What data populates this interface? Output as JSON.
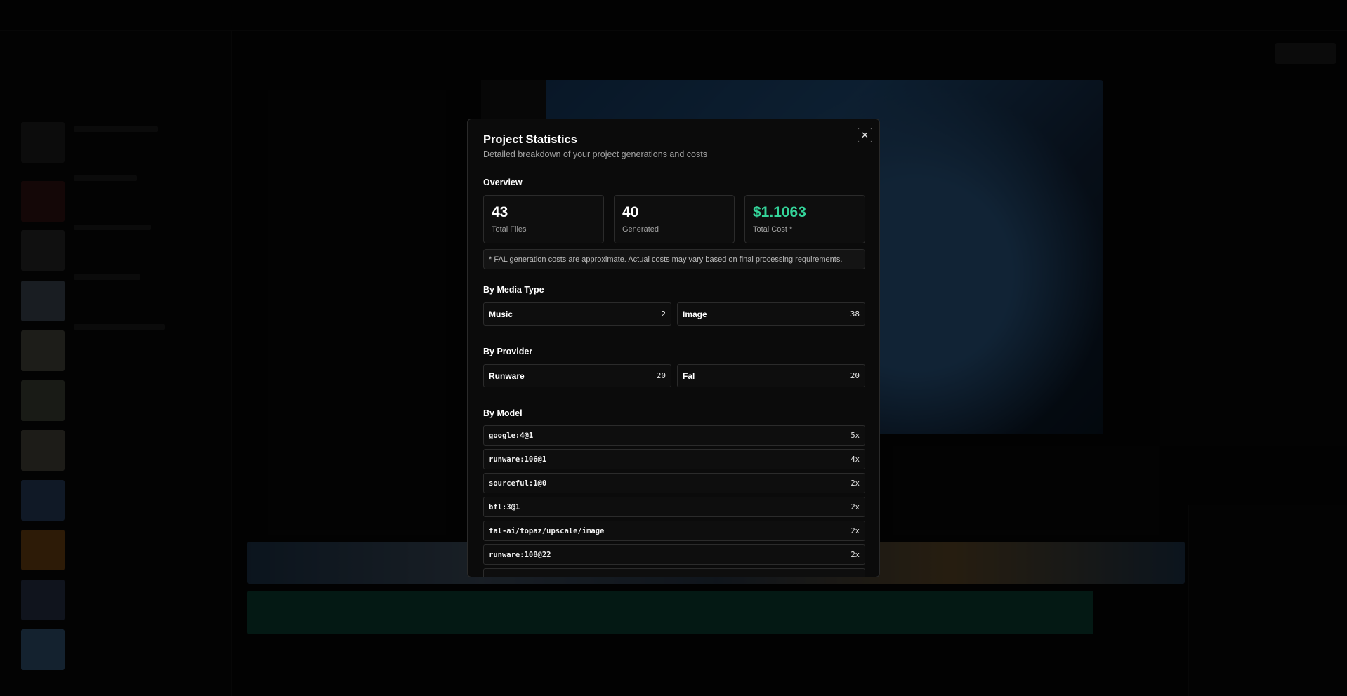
{
  "modal": {
    "title": "Project Statistics",
    "subtitle": "Detailed breakdown of your project generations and costs",
    "close_icon": "close-icon",
    "overview": {
      "heading": "Overview",
      "cards": [
        {
          "value": "43",
          "label": "Total Files"
        },
        {
          "value": "40",
          "label": "Generated"
        },
        {
          "value": "$1.1063",
          "label": "Total Cost *"
        }
      ],
      "note": "* FAL generation costs are approximate. Actual costs may vary based on final processing requirements."
    },
    "media_type": {
      "heading": "By Media Type",
      "items": [
        {
          "name": "Music",
          "count": "2"
        },
        {
          "name": "Image",
          "count": "38"
        }
      ]
    },
    "provider": {
      "heading": "By Provider",
      "items": [
        {
          "name": "Runware",
          "count": "20"
        },
        {
          "name": "Fal",
          "count": "20"
        }
      ]
    },
    "model": {
      "heading": "By Model",
      "items": [
        {
          "name": "google:4@1",
          "count": "5x"
        },
        {
          "name": "runware:106@1",
          "count": "4x"
        },
        {
          "name": "sourceful:1@0",
          "count": "2x"
        },
        {
          "name": "bfl:3@1",
          "count": "2x"
        },
        {
          "name": "fal-ai/topaz/upscale/image",
          "count": "2x"
        },
        {
          "name": "runware:108@22",
          "count": "2x"
        }
      ]
    }
  },
  "colors": {
    "accent_green": "#34d399",
    "modal_bg": "#0b0b0b",
    "border": "#2b2b2b"
  }
}
